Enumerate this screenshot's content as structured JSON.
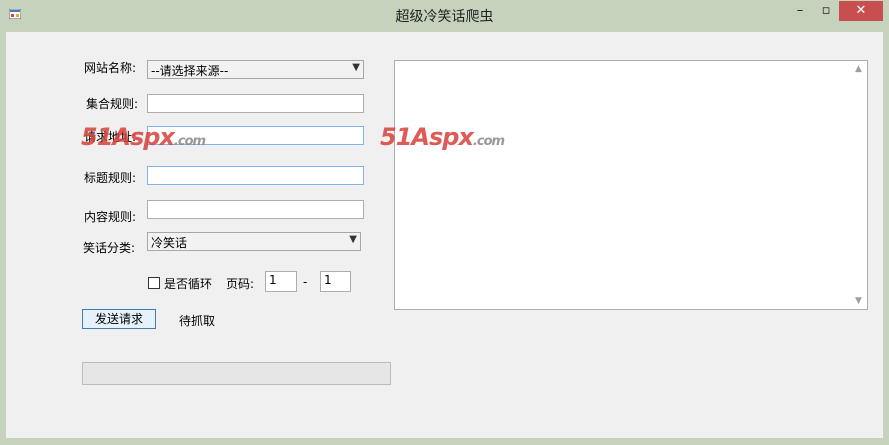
{
  "window": {
    "title": "超级冷笑话爬虫",
    "minimize_glyph": "–",
    "maximize_glyph": "▫",
    "close_glyph": "✕"
  },
  "form": {
    "site_name_label": "网站名称:",
    "site_name_value": "--请选择来源--",
    "collection_rule_label": "集合规则:",
    "collection_rule_value": "",
    "request_url_label": "请求地址:",
    "request_url_value": "",
    "title_rule_label": "标题规则:",
    "title_rule_value": "",
    "content_rule_label": "内容规则:",
    "content_rule_value": "",
    "category_label": "笑话分类:",
    "category_value": "冷笑话",
    "loop_label": "是否循环",
    "loop_checked": false,
    "page_label": "页码:",
    "page_from": "1",
    "page_separator": "-",
    "page_to": "1",
    "send_button": "发送请求",
    "status_text": "待抓取"
  },
  "progress": {
    "value": 0
  },
  "output": {
    "text": ""
  },
  "watermark": {
    "red_part": "51Aspx",
    "grey_part": ".com"
  }
}
